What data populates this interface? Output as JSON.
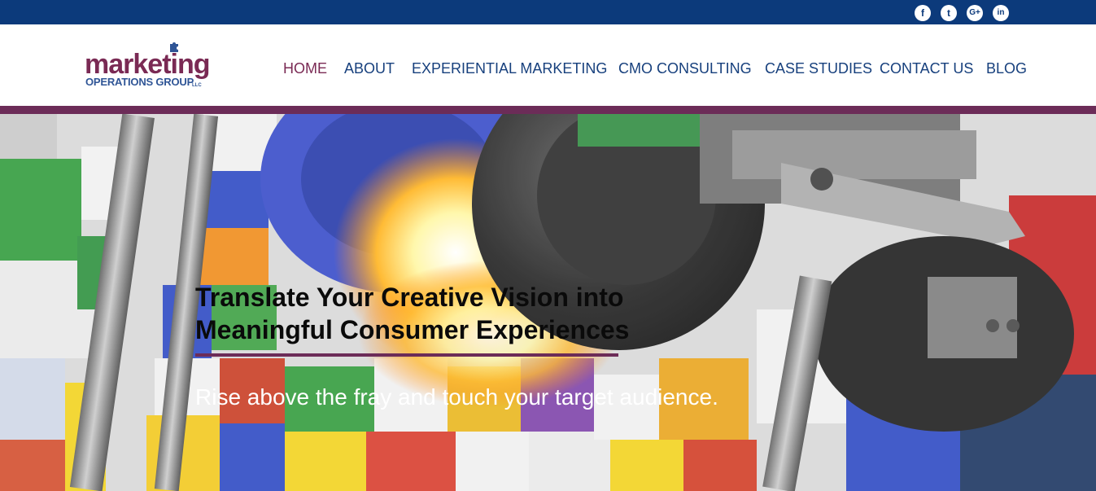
{
  "social": {
    "icons": [
      {
        "name": "facebook-icon",
        "glyph": "f"
      },
      {
        "name": "twitter-icon",
        "glyph": "t"
      },
      {
        "name": "google-plus-icon",
        "glyph": "G+"
      },
      {
        "name": "linkedin-icon",
        "glyph": "in"
      }
    ]
  },
  "logo": {
    "top_text": "marketing",
    "bottom_text": "OPERATIONS GROUP",
    "suffix": "LLC"
  },
  "nav": {
    "items": [
      {
        "label": "HOME",
        "active": true
      },
      {
        "label": "ABOUT",
        "active": false
      },
      {
        "label": "EXPERIENTIAL MARKETING",
        "active": false
      },
      {
        "label": "CMO CONSULTING",
        "active": false
      },
      {
        "label": "CASE STUDIES",
        "active": false
      },
      {
        "label": "CONTACT US",
        "active": false
      },
      {
        "label": "BLOG",
        "active": false
      }
    ]
  },
  "hero": {
    "title_line1": "Translate Your Creative Vision into",
    "title_line2": "Meaningful Consumer Experiences",
    "subtitle": "Rise above the fray and touch your target audience."
  },
  "colors": {
    "topbar": "#0c3a7b",
    "nav_text": "#17407d",
    "accent": "#7a2a54",
    "rule": "#6c2c58"
  }
}
